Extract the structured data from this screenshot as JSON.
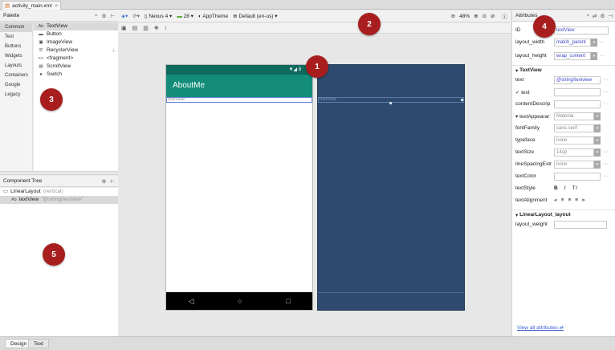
{
  "file_tab": {
    "name": "activity_main.xml"
  },
  "palette": {
    "title": "Palette",
    "categories": [
      "Common",
      "Text",
      "Buttons",
      "Widgets",
      "Layouts",
      "Containers",
      "Google",
      "Legacy"
    ],
    "items": [
      {
        "icon": "Ab",
        "label": "TextView"
      },
      {
        "icon": "▬",
        "label": "Button"
      },
      {
        "icon": "▣",
        "label": "ImageView"
      },
      {
        "icon": "☰",
        "label": "RecyclerView"
      },
      {
        "icon": "<>",
        "label": "<fragment>"
      },
      {
        "icon": "▤",
        "label": "ScrollView"
      },
      {
        "icon": "●",
        "label": "Switch"
      }
    ]
  },
  "component_tree": {
    "title": "Component Tree",
    "root_label": "LinearLayout",
    "root_suffix": "(vertical)",
    "child_icon": "Ab",
    "child_label": "textView",
    "child_value": "\"@string/textview\""
  },
  "toolbar": {
    "device": "Nexus 4",
    "api": "28",
    "theme": "AppTheme",
    "locale": "Default (en-us)",
    "zoom": "48%"
  },
  "preview": {
    "app_title": "AboutMe",
    "textview_text": "TextView",
    "status_text": "▼◢ 8"
  },
  "attributes": {
    "title": "Attributes",
    "id_label": "ID",
    "id_value": "textView",
    "layout_width_label": "layout_width",
    "layout_width_value": "match_parent",
    "layout_height_label": "layout_height",
    "layout_height_value": "wrap_content",
    "section_textview": "TextView",
    "text_label": "text",
    "text_value": "@string/textview",
    "tools_text_label": "✓ text",
    "content_desc_label": "contentDescrip",
    "text_appearance_label": "▾ textAppearar",
    "text_appearance_value": "Material",
    "font_family_label": "fontFamily",
    "font_family_value": "sans-serif",
    "typeface_label": "typeface",
    "typeface_value": "none",
    "text_size_label": "textSize",
    "text_size_value": "14sp",
    "line_spacing_label": "lineSpacingExtr",
    "line_spacing_value": "none",
    "text_color_label": "textColor",
    "text_style_label": "textStyle",
    "text_style_b": "B",
    "text_style_i": "I",
    "text_style_tt": "Tт",
    "text_alignment_label": "textAlignment",
    "section_linear": "LinearLayout_layout",
    "layout_weight_label": "layout_weight",
    "view_all": "View all attributes"
  },
  "bottom_tabs": [
    "Design",
    "Text"
  ],
  "callouts": [
    "1",
    "2",
    "3",
    "4",
    "5"
  ],
  "colors": {
    "status_bar": "#0e6a5d",
    "app_bar": "#138d7a",
    "blueprint": "#2e4a6e",
    "callout": "#a81e1e",
    "selection": "#6b84e0"
  }
}
